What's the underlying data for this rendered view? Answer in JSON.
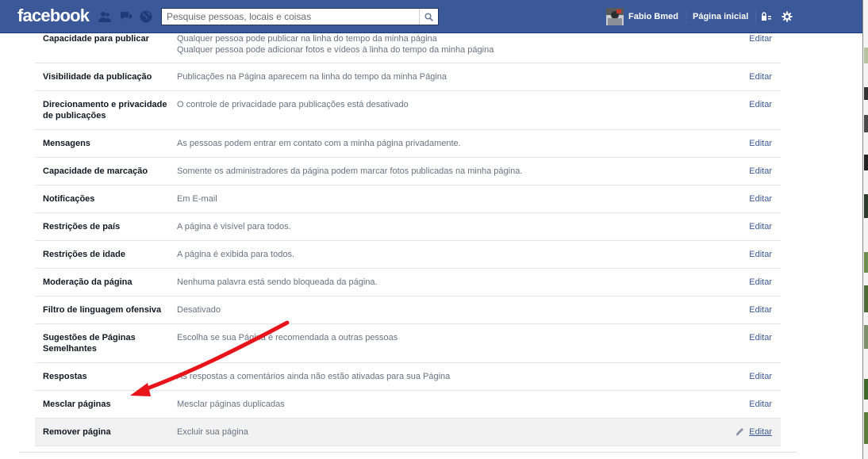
{
  "topbar": {
    "logo": "facebook",
    "search_placeholder": "Pesquise pessoas, locais e coisas",
    "user_name": "Fabio Bmed",
    "home_label": "Página inicial"
  },
  "settings": {
    "edit_label": "Editar",
    "rows": [
      {
        "label": "Capacidade para publicar",
        "desc": "Qualquer pessoa pode publicar na linha do tempo da minha página\nQualquer pessoa pode adicionar fotos e vídeos à linha do tempo da minha página"
      },
      {
        "label": "Visibilidade da publicação",
        "desc": "Publicações na Página aparecem na linha do tempo da minha Página"
      },
      {
        "label": "Direcionamento e privacidade de publicações",
        "desc": "O controle de privacidade para publicações está desativado"
      },
      {
        "label": "Mensagens",
        "desc": "As pessoas podem entrar em contato com a minha página privadamente."
      },
      {
        "label": "Capacidade de marcação",
        "desc": "Somente os administradores da página podem marcar fotos publicadas na minha página."
      },
      {
        "label": "Notificações",
        "desc": "Em E-mail"
      },
      {
        "label": "Restrições de país",
        "desc": "A página é visível para todos."
      },
      {
        "label": "Restrições de idade",
        "desc": "A página é exibida para todos."
      },
      {
        "label": "Moderação da página",
        "desc": "Nenhuma palavra está sendo bloqueada da página."
      },
      {
        "label": "Filtro de linguagem ofensiva",
        "desc": "Desativado"
      },
      {
        "label": "Sugestões de Páginas Semelhantes",
        "desc": "Escolha se sua Página é recomendada a outras pessoas"
      },
      {
        "label": "Respostas",
        "desc": "As respostas a comentários ainda não estão ativadas para sua Página"
      },
      {
        "label": "Mesclar páginas",
        "desc": "Mesclar páginas duplicadas"
      },
      {
        "label": "Remover página",
        "desc": "Excluir sua página"
      }
    ]
  },
  "colors": {
    "brand_blue": "#3b5998",
    "annotation_arrow": "#e8141b"
  }
}
